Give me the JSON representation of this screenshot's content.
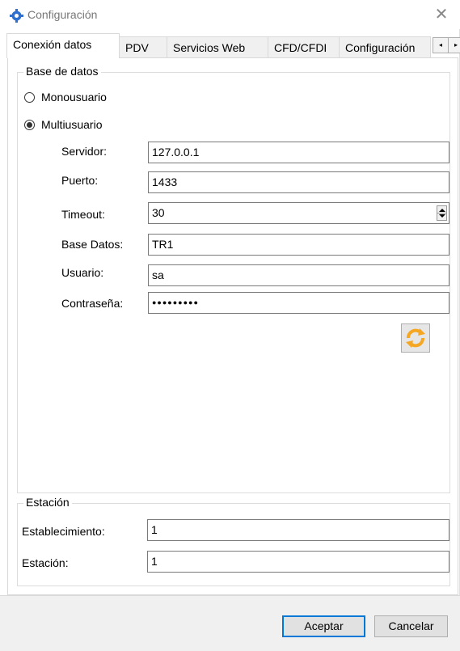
{
  "window": {
    "title": "Configuración",
    "close_icon": "close-icon"
  },
  "tabs": [
    {
      "label": "Conexión datos",
      "active": true
    },
    {
      "label": "PDV"
    },
    {
      "label": "Servicios Web"
    },
    {
      "label": "CFD/CFDI"
    },
    {
      "label": "Configuración"
    }
  ],
  "tab_scroll": {
    "left": "◂",
    "right": "▸"
  },
  "database": {
    "group_title": "Base de datos",
    "mode_options": [
      {
        "label": "Monousuario",
        "checked": false
      },
      {
        "label": "Multiusuario",
        "checked": true
      }
    ],
    "server_label": "Servidor:",
    "server_value": "127.0.0.1",
    "port_label": "Puerto:",
    "port_value": "1433",
    "timeout_label": "Timeout:",
    "timeout_value": "30",
    "dbname_label": "Base Datos:",
    "dbname_value": "TR1",
    "user_label": "Usuario:",
    "user_value": "sa",
    "password_label": "Contraseña:",
    "password_value": "●●●●●●●●●",
    "refresh_icon": "refresh-icon"
  },
  "station": {
    "group_title": "Estación",
    "establishment_label": "Establecimiento:",
    "establishment_value": "1",
    "station_label": "Estación:",
    "station_value": "1"
  },
  "footer": {
    "accept_label": "Aceptar",
    "cancel_label": "Cancelar"
  },
  "colors": {
    "accent": "#0078d7",
    "refresh_orange": "#f5a623",
    "title_icon_blue": "#2f6fcf"
  }
}
